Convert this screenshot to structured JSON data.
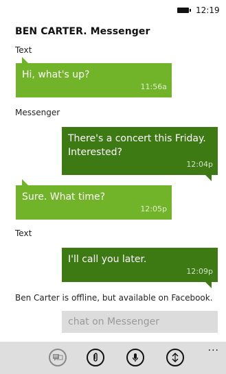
{
  "status": {
    "time": "12:19"
  },
  "conversation": {
    "title": "BEN CARTER. Messenger"
  },
  "labels": {
    "text1": "Text",
    "messenger": "Messenger",
    "text2": "Text"
  },
  "messages": [
    {
      "direction": "incoming",
      "text": "Hi, what's up?",
      "time": "11:56a"
    },
    {
      "direction": "outgoing",
      "text": "There's a concert this Friday. Interested?",
      "time": "12:04p"
    },
    {
      "direction": "incoming",
      "text": "Sure. What time?",
      "time": "12:05p"
    },
    {
      "direction": "outgoing",
      "text": "I'll call you later.",
      "time": "12:09p"
    }
  ],
  "offline_notice": "Ben Carter is offline, but available on Facebook.",
  "compose": {
    "placeholder": "chat on Messenger"
  },
  "appbar": {
    "icons": [
      "switch-chat-icon",
      "attach-icon",
      "microphone-icon",
      "switch-account-icon"
    ],
    "more": "..."
  },
  "colors": {
    "incoming": "#72b429",
    "outgoing": "#3d7a14",
    "appbar": "#dedede",
    "compose": "#dcdcdc"
  }
}
